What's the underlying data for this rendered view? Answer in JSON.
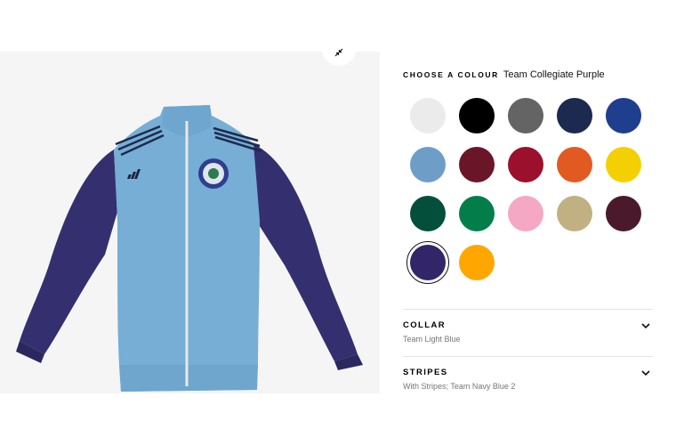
{
  "colour": {
    "label": "CHOOSE A COLOUR",
    "selected_name": "Team Collegiate Purple",
    "swatches": [
      {
        "name": "white",
        "hex": "#ebebeb"
      },
      {
        "name": "black",
        "hex": "#000000"
      },
      {
        "name": "grey",
        "hex": "#646464"
      },
      {
        "name": "navy",
        "hex": "#1b2a4e"
      },
      {
        "name": "royal-blue",
        "hex": "#1f3e8d"
      },
      {
        "name": "light-blue",
        "hex": "#6e9ec8"
      },
      {
        "name": "maroon",
        "hex": "#6a1628"
      },
      {
        "name": "red",
        "hex": "#9b102c"
      },
      {
        "name": "orange",
        "hex": "#e15a21"
      },
      {
        "name": "yellow",
        "hex": "#f4d000"
      },
      {
        "name": "dark-green",
        "hex": "#044f3b"
      },
      {
        "name": "green",
        "hex": "#037e4b"
      },
      {
        "name": "pink",
        "hex": "#f4a8c4"
      },
      {
        "name": "beige",
        "hex": "#c1b182"
      },
      {
        "name": "burgundy",
        "hex": "#4a1a2c"
      },
      {
        "name": "collegiate-purple",
        "hex": "#322568",
        "selected": true
      },
      {
        "name": "gold",
        "hex": "#ffa700"
      }
    ]
  },
  "collar": {
    "title": "COLLAR",
    "value": "Team Light Blue"
  },
  "stripes": {
    "title": "STRIPES",
    "value": "With Stripes; Team Navy Blue 2"
  },
  "jacket": {
    "body_color": "#76aed6",
    "sleeve_color": "#34306f",
    "stripe_color": "#1f2a4a"
  },
  "icons": {
    "expand": "collapse-arrows-icon",
    "chevron": "chevron-down-icon"
  }
}
